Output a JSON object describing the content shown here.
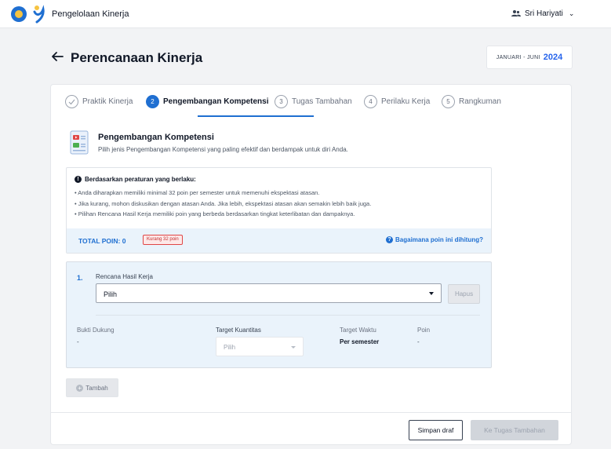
{
  "header": {
    "app_title": "Pengelolaan Kinerja",
    "user_name": "Sri Hariyati"
  },
  "page": {
    "title": "Perencanaan Kinerja",
    "period_range": "JANUARI - JUNI",
    "period_year": "2024"
  },
  "steps": [
    {
      "number": "✓",
      "label": "Praktik Kinerja",
      "state": "done"
    },
    {
      "number": "2",
      "label": "Pengembangan Kompetensi",
      "state": "active"
    },
    {
      "number": "3",
      "label": "Tugas Tambahan",
      "state": "pending"
    },
    {
      "number": "4",
      "label": "Perilaku Kerja",
      "state": "pending"
    },
    {
      "number": "5",
      "label": "Rangkuman",
      "state": "pending"
    }
  ],
  "section": {
    "title": "Pengembangan Kompetensi",
    "description": "Pilih jenis Pengembangan Kompetensi yang paling efektif dan berdampak untuk diri Anda."
  },
  "info": {
    "heading": "Berdasarkan peraturan yang berlaku:",
    "items": [
      "Anda diharapkan memiliki minimal 32 poin per semester untuk memenuhi ekspektasi atasan.",
      "Jika kurang, mohon diskusikan dengan atasan Anda. Jika lebih, ekspektasi atasan akan semakin lebih baik juga.",
      "Pilihan Rencana Hasil Kerja memiliki poin yang berbeda berdasarkan tingkat keterlibatan dan dampaknya."
    ],
    "total_label": "TOTAL POIN: 0",
    "badge": "Kurang 32 poin",
    "help_link": "Bagaimana poin ini dihitung?"
  },
  "item": {
    "number": "1.",
    "rhk_label": "Rencana Hasil Kerja",
    "rhk_value": "Pilih",
    "delete_label": "Hapus",
    "bukti_label": "Bukti Dukung",
    "bukti_value": "-",
    "target_kuantitas_label": "Target Kuantitas",
    "target_kuantitas_value": "Pilih",
    "target_waktu_label": "Target Waktu",
    "target_waktu_value": "Per semester",
    "poin_label": "Poin",
    "poin_value": "-"
  },
  "actions": {
    "add_label": "Tambah",
    "draft_label": "Simpan draf",
    "next_label": "Ke Tugas Tambahan"
  },
  "colors": {
    "accent": "#1f6fd1",
    "badge_red": "#e04646",
    "info_bg": "#eaf3fb"
  }
}
